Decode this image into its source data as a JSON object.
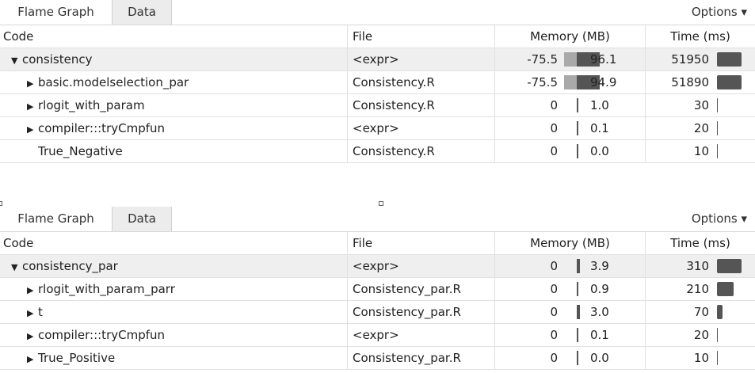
{
  "panels": [
    {
      "tabs": {
        "flame": "Flame Graph",
        "data": "Data"
      },
      "options": "Options ▾",
      "headers": {
        "code": "Code",
        "file": "File",
        "memory": "Memory (MB)",
        "time": "Time (ms)"
      },
      "rows": [
        {
          "toggle": "▼",
          "code": "consistency",
          "file": "<expr>",
          "mem_neg": "-75.5",
          "mem_pos": "96.1",
          "time": "51950",
          "mem_neg_frac": 0.79,
          "mem_pos_frac": 1.0,
          "time_frac": 1.0
        },
        {
          "toggle": "▶",
          "code": "basic.modelselection_par",
          "file": "Consistency.R",
          "mem_neg": "-75.5",
          "mem_pos": "94.9",
          "time": "51890",
          "mem_neg_frac": 0.79,
          "mem_pos_frac": 0.99,
          "time_frac": 1.0
        },
        {
          "toggle": "▶",
          "code": "rlogit_with_param",
          "file": "Consistency.R",
          "mem_neg": "0",
          "mem_pos": "1.0",
          "time": "30",
          "mem_neg_frac": 0,
          "mem_pos_frac": 0,
          "time_frac": 0
        },
        {
          "toggle": "▶",
          "code": "compiler:::tryCmpfun",
          "file": "<expr>",
          "mem_neg": "0",
          "mem_pos": "0.1",
          "time": "20",
          "mem_neg_frac": 0,
          "mem_pos_frac": 0,
          "time_frac": 0
        },
        {
          "toggle": "",
          "code": "True_Negative",
          "file": "Consistency.R",
          "mem_neg": "0",
          "mem_pos": "0.0",
          "time": "10",
          "mem_neg_frac": 0,
          "mem_pos_frac": 0,
          "time_frac": 0
        }
      ]
    },
    {
      "tabs": {
        "flame": "Flame Graph",
        "data": "Data"
      },
      "options": "Options ▾",
      "headers": {
        "code": "Code",
        "file": "File",
        "memory": "Memory (MB)",
        "time": "Time (ms)"
      },
      "rows": [
        {
          "toggle": "▼",
          "code": "consistency_par",
          "file": "<expr>",
          "mem_neg": "0",
          "mem_pos": "3.9",
          "time": "310",
          "mem_neg_frac": 0,
          "mem_pos_frac": 0.04,
          "time_frac": 1.0
        },
        {
          "toggle": "▶",
          "code": "rlogit_with_param_parr",
          "file": "Consistency_par.R",
          "mem_neg": "0",
          "mem_pos": "0.9",
          "time": "210",
          "mem_neg_frac": 0,
          "mem_pos_frac": 0.0,
          "time_frac": 0.68
        },
        {
          "toggle": "▶",
          "code": "t",
          "file": "Consistency_par.R",
          "mem_neg": "0",
          "mem_pos": "3.0",
          "time": "70",
          "mem_neg_frac": 0,
          "mem_pos_frac": 0.03,
          "time_frac": 0.23
        },
        {
          "toggle": "▶",
          "code": "compiler:::tryCmpfun",
          "file": "<expr>",
          "mem_neg": "0",
          "mem_pos": "0.1",
          "time": "20",
          "mem_neg_frac": 0,
          "mem_pos_frac": 0,
          "time_frac": 0.0
        },
        {
          "toggle": "▶",
          "code": "True_Positive",
          "file": "Consistency_par.R",
          "mem_neg": "0",
          "mem_pos": "0.0",
          "time": "10",
          "mem_neg_frac": 0,
          "mem_pos_frac": 0,
          "time_frac": 0.0
        }
      ]
    }
  ]
}
